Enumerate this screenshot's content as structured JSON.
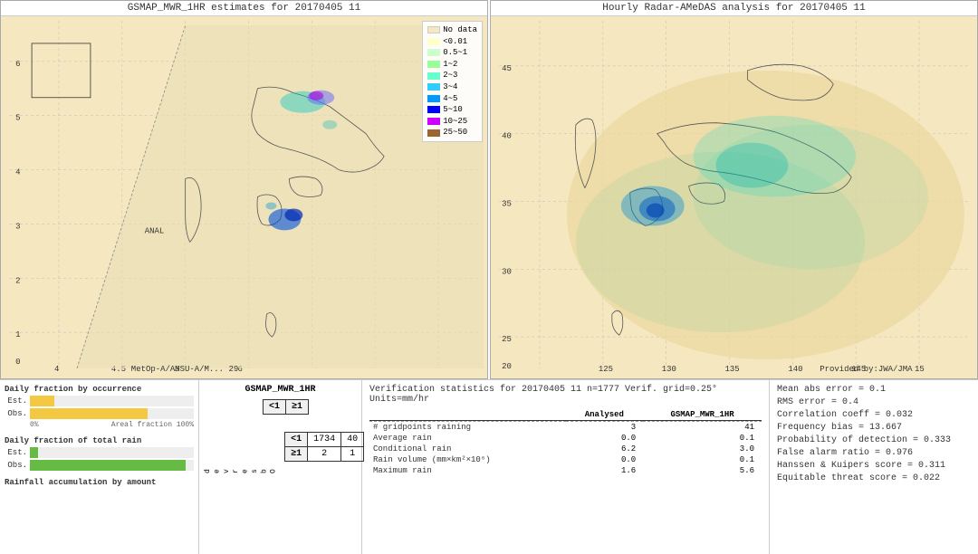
{
  "leftMap": {
    "title": "GSMAP_MWR_1HR estimates for 20170405 11",
    "subtitle": "MetOp-A/AMSU-A/M... 29",
    "annaLabel": "ANAL"
  },
  "rightMap": {
    "title": "Hourly Radar-AMeDAS analysis for 20170405 11",
    "credit": "Provided by:JWA/JMA"
  },
  "legend": {
    "title": "",
    "items": [
      {
        "label": "No data",
        "color": "#f5e8c0"
      },
      {
        "label": "<0.01",
        "color": "#ffffcc"
      },
      {
        "label": "0.5~1",
        "color": "#ccffcc"
      },
      {
        "label": "1~2",
        "color": "#99ff99"
      },
      {
        "label": "2~3",
        "color": "#66ffcc"
      },
      {
        "label": "3~4",
        "color": "#33ccff"
      },
      {
        "label": "4~5",
        "color": "#0099ff"
      },
      {
        "label": "5~10",
        "color": "#0000ff"
      },
      {
        "label": "10~25",
        "color": "#cc00ff"
      },
      {
        "label": "25~50",
        "color": "#996633"
      }
    ]
  },
  "leftChart": {
    "fractionTitle": "Daily fraction by occurrence",
    "estLabel": "Est.",
    "obsLabel": "Obs.",
    "axisStart": "0%",
    "axisEnd": "Areal fraction 100%",
    "estFraction": 0.15,
    "obsFraction": 0.72,
    "totalRainTitle": "Daily fraction of total rain",
    "estRainFraction": 0.05,
    "obsRainFraction": 0.95,
    "accumTitle": "Rainfall accumulation by amount"
  },
  "contingencyTable": {
    "title": "GSMAP_MWR_1HR",
    "estLabel": "<1",
    "estLabel2": "≥1",
    "obsLabel": "Observed",
    "obs1": "<1",
    "obs2": "≥1",
    "v11": "1734",
    "v12": "40",
    "v21": "2",
    "v22": "1"
  },
  "verificationStats": {
    "header": "Verification statistics for 20170405 11  n=1777  Verif. grid=0.25°  Units=mm/hr",
    "columns": [
      "Analysed",
      "GSMAP_MWR_1HR"
    ],
    "rows": [
      {
        "label": "# gridpoints raining",
        "analysed": "3",
        "gsmap": "41"
      },
      {
        "label": "Average rain",
        "analysed": "0.0",
        "gsmap": "0.1"
      },
      {
        "label": "Conditional rain",
        "analysed": "6.2",
        "gsmap": "3.0"
      },
      {
        "label": "Rain volume (mm×km²×10⁶)",
        "analysed": "0.0",
        "gsmap": "0.1"
      },
      {
        "label": "Maximum rain",
        "analysed": "1.6",
        "gsmap": "5.6"
      }
    ]
  },
  "metrics": {
    "items": [
      {
        "label": "Mean abs error = 0.1"
      },
      {
        "label": "RMS error = 0.4"
      },
      {
        "label": "Correlation coeff = 0.032"
      },
      {
        "label": "Frequency bias = 13.667"
      },
      {
        "label": "Probability of detection = 0.333"
      },
      {
        "label": "False alarm ratio = 0.976"
      },
      {
        "label": "Hanssen & Kuipers score = 0.311"
      },
      {
        "label": "Equitable threat score = 0.022"
      }
    ]
  }
}
